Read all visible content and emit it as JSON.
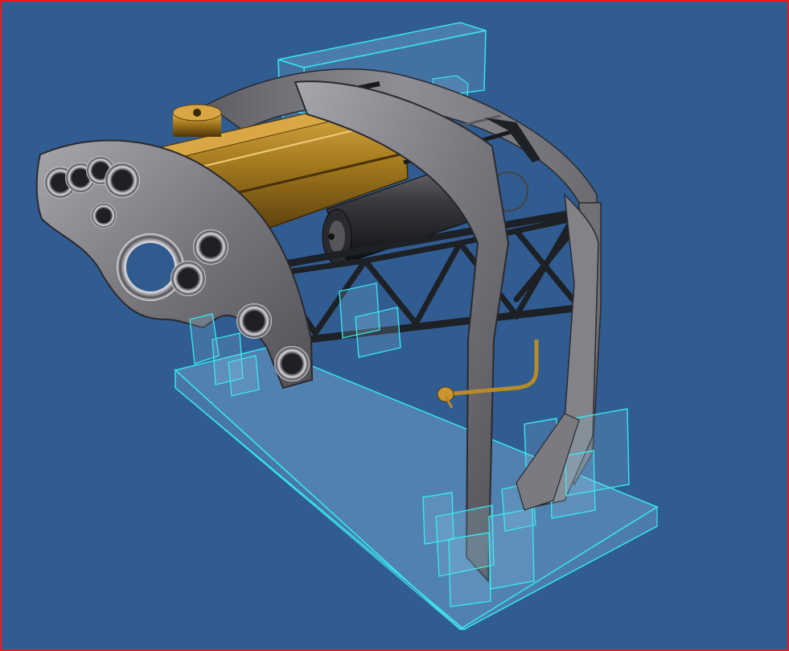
{
  "viewport": {
    "background": "#305c92",
    "border_color": "#e81b1b"
  },
  "model": {
    "colors": {
      "plate": "#6f6f75",
      "plate_light": "#9a9aa0",
      "plate_dark": "#3e3e44",
      "brass": "#a57b1f",
      "brass_light": "#d6a43d",
      "brass_dark": "#5a3d0c",
      "frame": "#1d2024",
      "wireframe": "#35e6ef",
      "ghost_fill": "#8fc6e8"
    },
    "components": {
      "base_block": "base-block-ghost",
      "left_arch_plate": "left-arch-plate",
      "right_arch_plate": "right-arch-plate",
      "brass_tank": "brass-tank",
      "motor": "motor-cylinder",
      "truss": "cross-braced-truss",
      "fixtures": "fixture-blocks-ghost"
    }
  }
}
